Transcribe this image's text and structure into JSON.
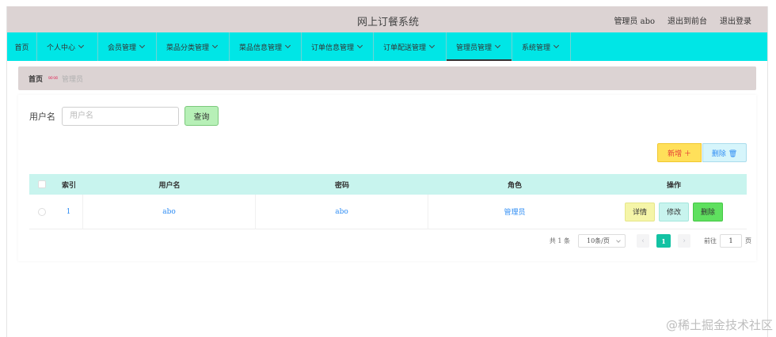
{
  "header": {
    "title": "网上订餐系统",
    "user": "管理员 abo",
    "goto_front": "退出到前台",
    "logout": "退出登录"
  },
  "nav": {
    "items": [
      {
        "label": "首页",
        "has_menu": false
      },
      {
        "label": "个人中心",
        "has_menu": true
      },
      {
        "label": "会员管理",
        "has_menu": true
      },
      {
        "label": "菜品分类管理",
        "has_menu": true
      },
      {
        "label": "菜品信息管理",
        "has_menu": true
      },
      {
        "label": "订单信息管理",
        "has_menu": true
      },
      {
        "label": "订单配送管理",
        "has_menu": true
      },
      {
        "label": "管理员管理",
        "has_menu": true,
        "active": true
      },
      {
        "label": "系统管理",
        "has_menu": true
      }
    ]
  },
  "breadcrumb": {
    "home": "首页",
    "separator": "∞∞",
    "current": "管理员"
  },
  "search": {
    "label": "用户名",
    "placeholder": "用户名",
    "button": "查询"
  },
  "actions": {
    "add": "新增 ＋",
    "delete": "删除 🗑"
  },
  "table": {
    "headers": {
      "index": "索引",
      "username": "用户名",
      "password": "密码",
      "role": "角色",
      "operation": "操作"
    },
    "rows": [
      {
        "index": "1",
        "username": "abo",
        "password": "abo",
        "role": "管理员"
      }
    ],
    "row_buttons": {
      "detail": "详情",
      "edit": "修改",
      "delete": "删除"
    }
  },
  "pagination": {
    "total": "共 1 条",
    "page_size": "10条/页",
    "prev": "‹",
    "current_page": "1",
    "next": "›",
    "goto_label": "前往",
    "goto_value": "1",
    "page_suffix": "页"
  },
  "watermark": "@稀土掘金技术社区",
  "colors": {
    "header_bg": "#dcd3d3",
    "nav_bg": "#00e6e6",
    "table_head_bg": "#c8f4ee",
    "add_btn": "#ffe05a",
    "delete_row_btn": "#5fe05f",
    "page_active": "#13c2a3"
  }
}
